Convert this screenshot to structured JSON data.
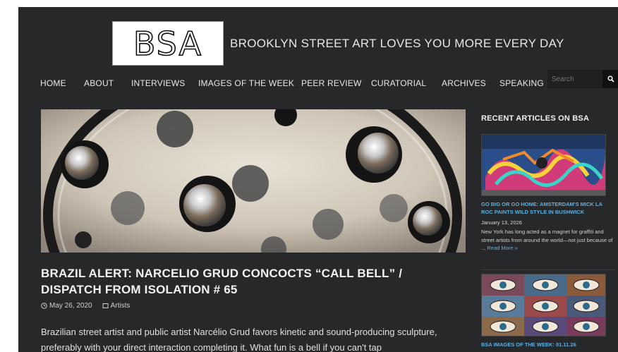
{
  "header": {
    "logo_text": "BSA",
    "tagline": "BROOKLYN STREET ART LOVES YOU MORE EVERY DAY"
  },
  "nav": {
    "items": [
      "HOME",
      "ABOUT",
      "INTERVIEWS",
      "IMAGES OF THE WEEK",
      "PEER REVIEW",
      "CURATORIAL",
      "ARCHIVES",
      "SPEAKING"
    ],
    "search_placeholder": "Search"
  },
  "post": {
    "title": "BRAZIL ALERT: NARCELIO GRUD CONCOCTS “CALL BELL” / DISPATCH FROM ISOLATION # 65",
    "date": "May 26, 2020",
    "category": "Artists",
    "excerpt": "Brazilian street artist and public artist Narcélio Grud favors kinetic and sound-producing sculpture, preferably with your direct interaction completing it. What fun is a bell if you can't tap"
  },
  "sidebar": {
    "title": "RECENT ARTICLES ON BSA",
    "articles": [
      {
        "title": "GO BIG OR GO HOME: AMSTERDAM'S MICK LA ROC PAINTS WILD STYLE IN BUSHWICK",
        "date": "January 13, 2026",
        "text": "New York has long acted as a magnet for graffiti and street artists from around the world—not just because of ...",
        "read_more": "Read More »"
      },
      {
        "title": "BSA IMAGES OF THE WEEK: 01.11.26"
      }
    ]
  },
  "colors": {
    "background": "#262829",
    "text": "#e8e8e8",
    "link": "#5fb0e0"
  }
}
